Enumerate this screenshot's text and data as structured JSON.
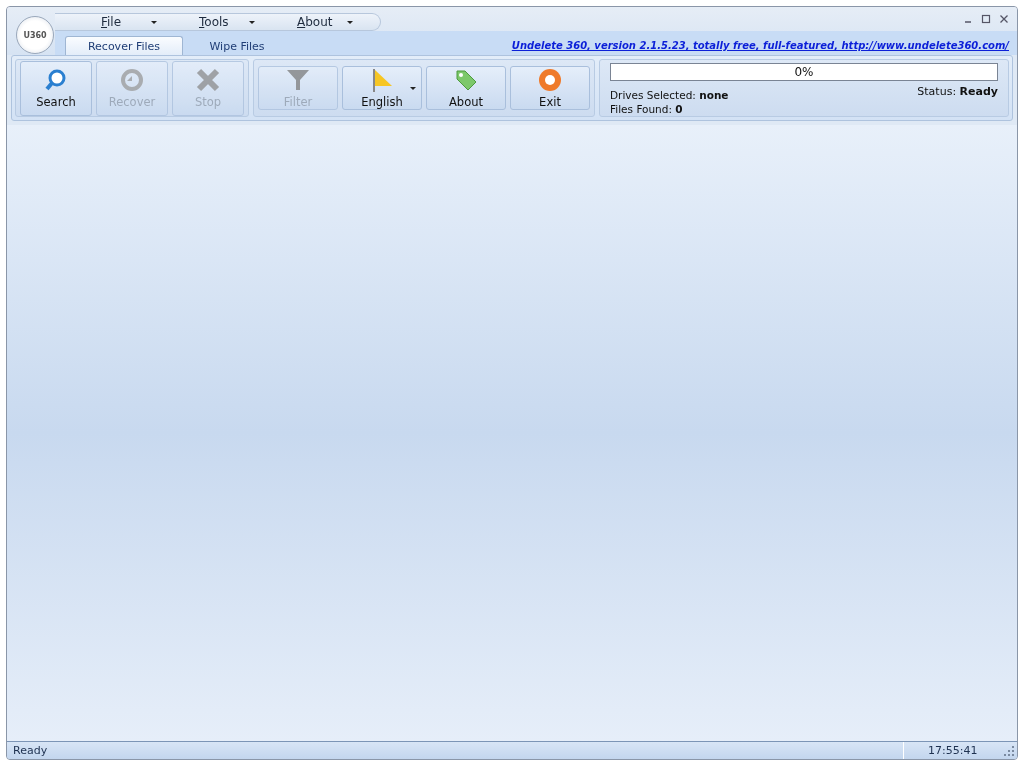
{
  "logo": {
    "text": "U360"
  },
  "menu": [
    {
      "label": "File"
    },
    {
      "label": "Tools"
    },
    {
      "label": "About"
    }
  ],
  "tabs": [
    {
      "label": "Recover Files",
      "selected": true
    },
    {
      "label": "Wipe Files",
      "selected": false
    }
  ],
  "banner_link": "Undelete 360, version 2.1.5.23, totally free, full-featured, http://www.undelete360.com/",
  "toolbar_groups": [
    [
      {
        "label": "Search",
        "kind": "search",
        "disabled": false,
        "dropdown": false
      },
      {
        "label": "Recover",
        "kind": "recover",
        "disabled": true,
        "dropdown": false
      },
      {
        "label": "Stop",
        "kind": "stop",
        "disabled": true,
        "dropdown": false
      }
    ],
    [
      {
        "label": "Filter",
        "kind": "filter",
        "disabled": true,
        "dropdown": false
      },
      {
        "label": "English",
        "kind": "language",
        "disabled": false,
        "dropdown": true
      },
      {
        "label": "About",
        "kind": "about",
        "disabled": false,
        "dropdown": false
      },
      {
        "label": "Exit",
        "kind": "exit",
        "disabled": false,
        "dropdown": false
      }
    ]
  ],
  "progress": {
    "level": 0,
    "reading": "0%"
  },
  "info": {
    "drives_label": "Drives Selected:",
    "drives_value": "none",
    "files_label": "Files Found:",
    "files_value": "0",
    "status_label": "Status:",
    "status_value": "Ready"
  },
  "status_bar": {
    "message": "Ready",
    "time": "17:55:41"
  }
}
